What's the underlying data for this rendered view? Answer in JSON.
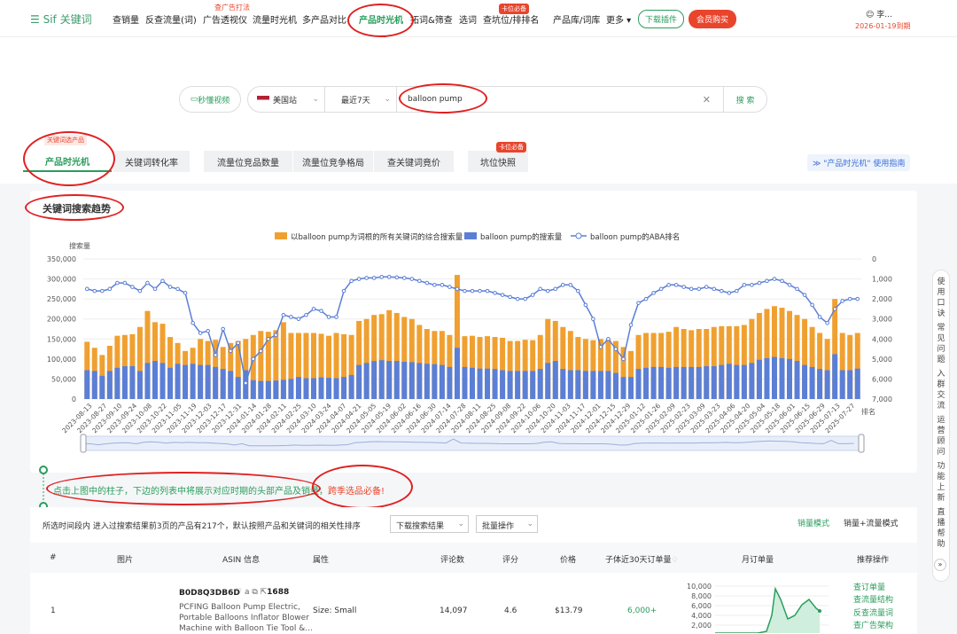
{
  "nav": {
    "logo": "Sif 关键词",
    "items": [
      "查销量",
      "反查流量(词)",
      "广告透视仪",
      "流量时光机",
      "多产品对比",
      "产品时光机",
      "拓词&筛查",
      "选词",
      "查坑位/排排名",
      "产品库/词库",
      "更多"
    ],
    "ad_badge": "查广告打法",
    "pit_badge": "卡位必备",
    "download": "下载插件",
    "member": "会员购买",
    "user": "李...",
    "expire": "2026-01-19到期"
  },
  "search": {
    "video_btn": "秒懂视频",
    "site": "美国站",
    "range": "最近7天",
    "keyword": "balloon pump",
    "submit": "搜 索"
  },
  "tabs": {
    "items": [
      "产品时光机",
      "关键词转化率",
      "流量位竞品数量",
      "流量位竞争格局",
      "查关键词竟价",
      "坑位快照"
    ],
    "tag_keyword": "关键词选产品",
    "tag_pit": "卡位必备",
    "guide": "\"产品时光机\" 使用指南"
  },
  "trend": {
    "title": "关键词搜索趋势"
  },
  "chart_data": {
    "type": "bar",
    "title": "",
    "ylabel": "搜索量",
    "y2label": "排名",
    "ylim": [
      0,
      350000
    ],
    "y2lim": [
      0,
      7000
    ],
    "y_ticks": [
      "350,000",
      "300,000",
      "250,000",
      "200,000",
      "150,000",
      "100,000",
      "50,000",
      "0"
    ],
    "y2_ticks": [
      "0",
      "1,000",
      "2,000",
      "3,000",
      "4,000",
      "5,000",
      "6,000",
      "7,000"
    ],
    "x_ticks": [
      "2023-08-13",
      "2023-08-27",
      "2023-09-10",
      "2023-09-24",
      "2023-10-08",
      "2023-10-22",
      "2023-11-05",
      "2023-11-19",
      "2023-12-03",
      "2023-12-17",
      "2023-12-31",
      "2024-01-14",
      "2024-01-28",
      "2024-02-11",
      "2024-02-25",
      "2024-03-10",
      "2024-03-24",
      "2024-04-07",
      "2024-04-21",
      "2024-05-05",
      "2024-05-19",
      "2024-06-02",
      "2024-06-16",
      "2024-06-30",
      "2024-07-14",
      "2024-07-28",
      "2024-08-11",
      "2024-08-25",
      "2024-09-08",
      "2024-09-22",
      "2024-10-06",
      "2024-10-20",
      "2024-11-03",
      "2024-11-17",
      "2024-12-01",
      "2024-12-15",
      "2024-12-29",
      "2025-01-12",
      "2025-01-26",
      "2025-02-09",
      "2025-02-23",
      "2025-03-09",
      "2025-03-23",
      "2025-04-06",
      "2025-04-20",
      "2025-05-04",
      "2025-05-18",
      "2025-06-01",
      "2025-06-15",
      "2025-06-29",
      "2025-07-13",
      "2025-07-27"
    ],
    "series": [
      {
        "name": "以balloon pump为词根的所有关键词的综合搜索量",
        "type": "bar",
        "color": "#f0a030",
        "values": [
          143000,
          128000,
          110000,
          133000,
          158000,
          160000,
          162000,
          180000,
          220000,
          192000,
          188000,
          155000,
          140000,
          120000,
          128000,
          150000,
          145000,
          148000,
          130000,
          140000,
          145000,
          150000,
          160000,
          170000,
          168000,
          172000,
          192000,
          165000,
          165000,
          165000,
          165000,
          163000,
          158000,
          165000,
          162000,
          160000,
          195000,
          200000,
          210000,
          212000,
          222000,
          215000,
          205000,
          200000,
          185000,
          175000,
          170000,
          170000,
          160000,
          310000,
          157000,
          158000,
          155000,
          157000,
          155000,
          153000,
          145000,
          145000,
          148000,
          147000,
          160000,
          200000,
          195000,
          180000,
          170000,
          155000,
          150000,
          147000,
          150000,
          148000,
          145000,
          130000,
          120000,
          160000,
          165000,
          165000,
          165000,
          168000,
          180000,
          175000,
          172000,
          175000,
          175000,
          180000,
          182000,
          182000,
          182000,
          185000,
          200000,
          215000,
          225000,
          232000,
          228000,
          220000,
          210000,
          200000,
          180000,
          165000,
          150000,
          250000,
          165000,
          160000,
          165000
        ]
      },
      {
        "name": "balloon pump的搜索量",
        "type": "bar",
        "color": "#5b7fd6",
        "values": [
          72000,
          70000,
          58000,
          70000,
          78000,
          82000,
          82000,
          70000,
          90000,
          95000,
          90000,
          78000,
          88000,
          85000,
          88000,
          85000,
          85000,
          80000,
          75000,
          70000,
          55000,
          72000,
          47000,
          45000,
          45000,
          46000,
          48000,
          50000,
          55000,
          52000,
          52000,
          54000,
          53000,
          52000,
          55000,
          60000,
          85000,
          90000,
          95000,
          97000,
          95000,
          95000,
          93000,
          92000,
          90000,
          88000,
          87000,
          85000,
          80000,
          128000,
          80000,
          78000,
          76000,
          76000,
          75000,
          72000,
          70000,
          70000,
          70000,
          70000,
          75000,
          90000,
          95000,
          75000,
          72000,
          72000,
          70000,
          70000,
          70000,
          70000,
          65000,
          55000,
          55000,
          75000,
          78000,
          80000,
          80000,
          78000,
          80000,
          80000,
          80000,
          80000,
          82000,
          82000,
          85000,
          88000,
          85000,
          85000,
          90000,
          98000,
          102000,
          105000,
          102000,
          100000,
          95000,
          85000,
          80000,
          75000,
          72000,
          112000,
          72000,
          72000,
          76000
        ]
      },
      {
        "name": "balloon pump的ABA排名",
        "type": "line",
        "color": "#5b7fd6",
        "values": [
          1500,
          1600,
          1600,
          1500,
          1200,
          1200,
          1400,
          1600,
          1200,
          1500,
          1100,
          1400,
          1500,
          1700,
          3200,
          3700,
          3600,
          4800,
          3500,
          4600,
          4200,
          6200,
          5000,
          4600,
          4000,
          3800,
          2800,
          2900,
          3000,
          2800,
          2500,
          2600,
          2900,
          2900,
          1600,
          1100,
          1000,
          950,
          950,
          900,
          900,
          920,
          950,
          1000,
          1100,
          1200,
          1300,
          1300,
          1400,
          1500,
          1600,
          1600,
          1600,
          1600,
          1700,
          1800,
          1900,
          2000,
          2000,
          1800,
          1500,
          1600,
          1500,
          1300,
          1300,
          1600,
          2300,
          3000,
          4400,
          4000,
          4500,
          5000,
          3300,
          2200,
          2000,
          1700,
          1500,
          1300,
          1300,
          1400,
          1500,
          1500,
          1400,
          1500,
          1600,
          1700,
          1600,
          1300,
          1300,
          1200,
          1100,
          1000,
          1100,
          1300,
          1500,
          1800,
          2300,
          2900,
          3200,
          2500,
          2100,
          2000,
          2000
        ]
      }
    ],
    "legend_position": "top-center",
    "grid": true
  },
  "hint": {
    "text": "点击上图中的柱子，下边的列表中将展示对应时期的头部产品及销量，",
    "highlight": "跨季选品必备!"
  },
  "list": {
    "summary": "所选时间段内 进入过搜索结果前3页的产品有217个，默认按照产品和关键词的相关性排序",
    "download": "下载搜索结果",
    "batch": "批量操作",
    "mode_sales": "销量模式",
    "mode_traffic": "销量+流量模式",
    "headers": [
      "#",
      "图片",
      "ASIN 信息",
      "属性",
      "评论数",
      "评分",
      "价格",
      "子体近30天订单量",
      "月订单量",
      "推荐操作"
    ],
    "rows": [
      {
        "index": "1",
        "asin": "B0D8Q3DB6D",
        "asin_count": "1688",
        "title_lines": [
          "PCFING Balloon Pump Electric,",
          "Portable Balloons Inflator Blower",
          "Machine with Balloon Tie Tool &..."
        ],
        "attr": "Size: Small",
        "reviews": "14,097",
        "rating": "4.6",
        "price": "$13.79",
        "orders": "6,000+",
        "mini_ticks": [
          "10,000",
          "8,000",
          "6,000",
          "4,000",
          "2,000"
        ],
        "ops": [
          "查订单量",
          "查流量结构",
          "反查流量词",
          "查广告架构"
        ]
      }
    ]
  },
  "side": [
    "使",
    "用",
    "口",
    "诀",
    "常",
    "见",
    "问",
    "题",
    "入",
    "群",
    "交",
    "流",
    "运",
    "营",
    "顾",
    "问",
    "功",
    "能",
    "上",
    "新",
    "直",
    "播",
    "帮",
    "助"
  ]
}
